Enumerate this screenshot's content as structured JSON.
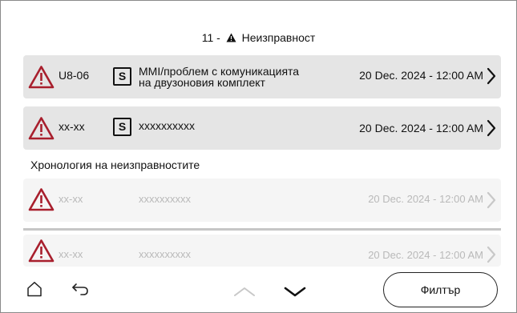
{
  "header": {
    "count": "11",
    "separator": "-",
    "title": "Неизправност"
  },
  "active_faults": [
    {
      "code": "U8-06",
      "badge": "S",
      "description_line1": "MMI/проблем с комуникацията",
      "description_line2": "на двузоновия комплект",
      "date": "20 Dec. 2024 - 12:00 AM"
    },
    {
      "code": "xx-xx",
      "badge": "S",
      "description_line1": "xxxxxxxxxx",
      "description_line2": "",
      "date": "20 Dec. 2024 - 12:00 AM"
    }
  ],
  "history": {
    "label": "Хронология на неизправностите",
    "items": [
      {
        "code": "xx-xx",
        "description": "xxxxxxxxxx",
        "date": "20 Dec. 2024 - 12:00 AM"
      },
      {
        "code": "xx-xx",
        "description": "xxxxxxxxxx",
        "date": "20 Dec. 2024 - 12:00 AM"
      }
    ]
  },
  "footer": {
    "filter_label": "Филтър"
  },
  "colors": {
    "alert_red": "#a81f2d",
    "row_bg": "#e5e5e5",
    "faded_row_bg": "#f5f5f5",
    "faded_text": "#b9b9b9"
  },
  "icons": {
    "alert": "warning-triangle-icon",
    "home": "home-icon",
    "back": "back-arrow-icon",
    "up": "chevron-up-icon",
    "down": "chevron-down-icon",
    "row_arrow": "chevron-right-icon"
  }
}
